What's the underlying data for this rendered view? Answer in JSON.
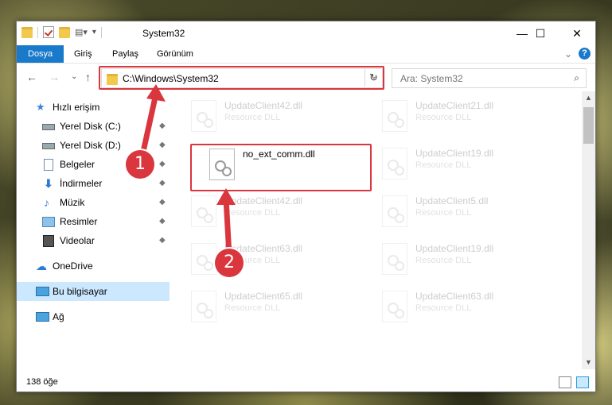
{
  "window": {
    "title": "System32"
  },
  "controls": {
    "minimize": "—",
    "maximize": "☐",
    "close": "✕"
  },
  "ribbon": {
    "tabs": [
      "Dosya",
      "Giriş",
      "Paylaş",
      "Görünüm"
    ],
    "expand": "⌄",
    "help": "?"
  },
  "nav": {
    "back": "←",
    "forward": "→",
    "recent": "⌄",
    "up": "↑"
  },
  "address": {
    "path": "C:\\Windows\\System32",
    "dropdown": "⌄",
    "refresh": "↻"
  },
  "search": {
    "placeholder": "Ara: System32",
    "icon": "⌕"
  },
  "sidebar": {
    "items": [
      {
        "label": "Hızlı erişim",
        "icon": "star-icon"
      },
      {
        "label": "Yerel Disk (C:)",
        "icon": "drive-icon",
        "pinned": true
      },
      {
        "label": "Yerel Disk (D:)",
        "icon": "drive-icon",
        "pinned": true
      },
      {
        "label": "Belgeler",
        "icon": "documents-icon",
        "pinned": true
      },
      {
        "label": "İndirmeler",
        "icon": "downloads-icon",
        "pinned": true
      },
      {
        "label": "Müzik",
        "icon": "music-icon",
        "pinned": true
      },
      {
        "label": "Resimler",
        "icon": "pictures-icon",
        "pinned": true
      },
      {
        "label": "Videolar",
        "icon": "videos-icon",
        "pinned": true
      },
      {
        "label": "OneDrive",
        "icon": "cloud-icon"
      },
      {
        "label": "Bu bilgisayar",
        "icon": "computer-icon"
      },
      {
        "label": "Ağ",
        "icon": "network-icon"
      }
    ],
    "pin": "📌"
  },
  "files": [
    {
      "name": "UpdateClient42.dll",
      "type": "Resource DLL"
    },
    {
      "name": "UpdateClient21.dll",
      "type": "Resource DLL"
    },
    {
      "name": "no_ext_comm.dll",
      "type": ""
    },
    {
      "name": "UpdateClient19.dll",
      "type": "Resource DLL"
    },
    {
      "name": "UpdateClient42.dll",
      "type": "Resource DLL"
    },
    {
      "name": "UpdateClient5.dll",
      "type": "Resource DLL"
    },
    {
      "name": "UpdateClient63.dll",
      "type": "Resource DLL"
    },
    {
      "name": "UpdateClient19.dll",
      "type": "Resource DLL"
    },
    {
      "name": "UpdateClient65.dll",
      "type": "Resource DLL"
    },
    {
      "name": "UpdateClient63.dll",
      "type": "Resource DLL"
    }
  ],
  "status": {
    "count": "138 öğe"
  },
  "callouts": {
    "one": "1",
    "two": "2"
  },
  "colors": {
    "accent": "#1979ca",
    "highlight": "#d9363e",
    "selected": "#cce8ff"
  }
}
